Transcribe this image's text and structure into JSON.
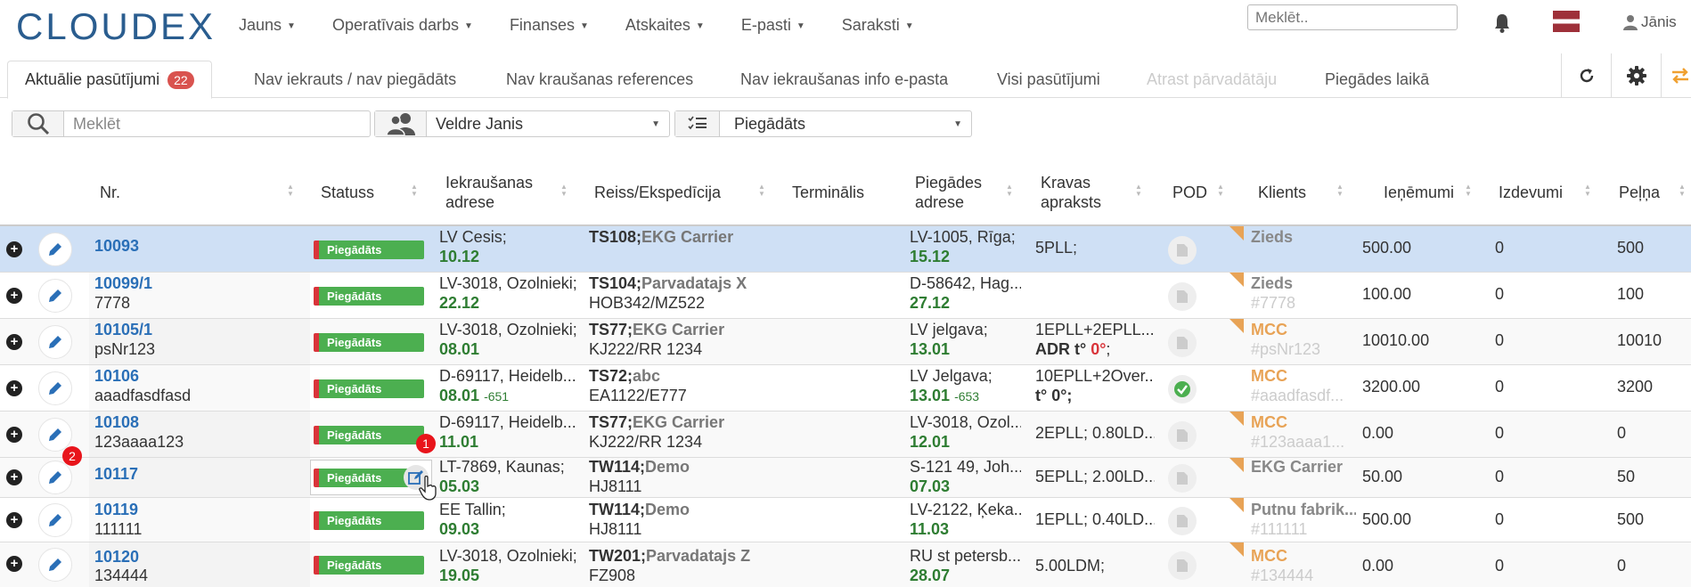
{
  "nav": {
    "logo": "CLOUDEX",
    "menu": [
      "Jauns",
      "Operatīvais darbs",
      "Finanses",
      "Atskaites",
      "E-pasti",
      "Saraksti"
    ],
    "search_placeholder": "Meklēt..",
    "user": "Jānis",
    "flag_color": "#9e3039"
  },
  "tabs": {
    "items": [
      {
        "label": "Aktuālie pasūtījumi",
        "badge": "22",
        "state": "active"
      },
      {
        "label": "Nav iekrauts / nav piegādāts",
        "state": "normal"
      },
      {
        "label": "Nav kraušanas references",
        "state": "normal"
      },
      {
        "label": "Nav iekraušanas info e-pasta",
        "state": "normal"
      },
      {
        "label": "Visi pasūtījumi",
        "state": "normal"
      },
      {
        "label": "Atrast pārvadātāju",
        "state": "disabled"
      },
      {
        "label": "Piegādes laikā",
        "state": "normal"
      }
    ],
    "tools": [
      "refresh-icon",
      "gear-icon",
      "swap-icon"
    ]
  },
  "filters": {
    "search_placeholder": "Meklēt",
    "user_value": "Veldre Janis",
    "status_value": "Piegādāts"
  },
  "table": {
    "headers": {
      "nr": "Nr.",
      "status": "Statuss",
      "loading_1": "Iekraušanas",
      "loading_2": "adrese",
      "trip": "Reiss/Ekspedīcija",
      "terminal": "Terminālis",
      "delivery_1": "Piegādes",
      "delivery_2": "adrese",
      "cargo_1": "Kravas",
      "cargo_2": "apraksts",
      "pod": "POD",
      "client": "Klients",
      "income": "Ieņēmumi",
      "expenses": "Izdevumi",
      "profit": "Peļņa"
    },
    "status_label": "Piegādāts",
    "rows": [
      {
        "nr": "10093",
        "nr_sub": "",
        "load_addr": "LV Cesis;",
        "load_date": "10.12",
        "trip": "TS108;",
        "carrier": "EKG Carrier",
        "trip_sub": "",
        "del_addr": "LV-1005, Rīga;",
        "del_date": "15.12",
        "del_extra": "",
        "cargo": "5PLL;",
        "cargo_sub": "",
        "client": "Zieds",
        "client_sub": "",
        "income": "500.00",
        "expenses": "0",
        "profit": "500"
      },
      {
        "nr": "10099/1",
        "nr_sub": "7778",
        "load_addr": "LV-3018, Ozolnieki;",
        "load_date": "22.12",
        "trip": "TS104;",
        "carrier": "Parvadatajs X",
        "trip_sub": "HOB342/MZ522",
        "del_addr": "D-58642, Hag...",
        "del_date": "27.12",
        "del_extra": "",
        "cargo": "",
        "cargo_sub": "",
        "client": "Zieds",
        "client_sub": "#7778",
        "income": "100.00",
        "expenses": "0",
        "profit": "100"
      },
      {
        "nr": "10105/1",
        "nr_sub": "psNr123",
        "load_addr": "LV-3018, Ozolnieki;",
        "load_date": "08.01",
        "trip": "TS77;",
        "carrier": "EKG Carrier",
        "trip_sub": "KJ222/RR 1234",
        "del_addr": "LV jelgava;",
        "del_date": "13.01",
        "del_extra": "",
        "cargo": "1EPLL+2EPLL...",
        "cargo_sub": "ADR t° 0°;",
        "client": "MCC",
        "client_sub": "#psNr123",
        "income": "10010.00",
        "expenses": "0",
        "profit": "10010"
      },
      {
        "nr": "10106",
        "nr_sub": "aaadfasdfasd",
        "load_addr": "D-69117, Heidelb...",
        "load_date": "08.01",
        "load_extra": "-651",
        "trip": "TS72;",
        "carrier": "abc",
        "trip_sub": "EA1122/E777",
        "del_addr": "LV Jelgava;",
        "del_date": "13.01",
        "del_extra": "-653",
        "cargo": "10EPLL+2Over...",
        "cargo_sub": "t° 0°;",
        "client": "MCC",
        "client_sub": "#aaadfasdf...",
        "income": "3200.00",
        "expenses": "0",
        "profit": "3200"
      },
      {
        "nr": "10108",
        "nr_sub": "123aaaa123",
        "load_addr": "D-69117, Heidelb...",
        "load_date": "11.01",
        "trip": "TS77;",
        "carrier": "EKG Carrier",
        "trip_sub": "KJ222/RR 1234",
        "del_addr": "LV-3018, Ozol...",
        "del_date": "12.01",
        "del_extra": "",
        "cargo": "2EPLL; 0.80LD...",
        "cargo_sub": "",
        "client": "MCC",
        "client_sub": "#123aaaa1...",
        "income": "0.00",
        "expenses": "0",
        "profit": "0"
      },
      {
        "nr": "10117",
        "nr_sub": "",
        "load_addr": "LT-7869, Kaunas;",
        "load_date": "05.03",
        "trip": "TW114;",
        "carrier": "Demo",
        "trip_sub": "HJ8111",
        "del_addr": "S-121 49, Joh...",
        "del_date": "07.03",
        "del_extra": "",
        "cargo": "5EPLL; 2.00LD...",
        "cargo_sub": "",
        "client": "EKG Carrier",
        "client_sub": "",
        "income": "50.00",
        "expenses": "0",
        "profit": "50"
      },
      {
        "nr": "10119",
        "nr_sub": "111111",
        "load_addr": "EE Tallin;",
        "load_date": "09.03",
        "trip": "TW114;",
        "carrier": "Demo",
        "trip_sub": "HJ8111",
        "del_addr": "LV-2122, Ķeka...",
        "del_date": "11.03",
        "del_extra": "",
        "cargo": "1EPLL; 0.40LD...",
        "cargo_sub": "",
        "client": "Putnu fabrik...",
        "client_sub": "#111111",
        "income": "500.00",
        "expenses": "0",
        "profit": "500"
      },
      {
        "nr": "10120",
        "nr_sub": "134444",
        "load_addr": "LV-3018, Ozolnieki;",
        "load_date": "19.05",
        "trip": "TW201;",
        "carrier": "Parvadatajs Z",
        "trip_sub": "FZ908",
        "del_addr": "RU st petersb...",
        "del_date": "28.07",
        "del_extra": "",
        "cargo": "5.00LDM;",
        "cargo_sub": "",
        "client": "MCC",
        "client_sub": "#134444",
        "income": "0.00",
        "expenses": "0",
        "profit": "0"
      }
    ]
  },
  "markers": [
    "1",
    "2"
  ],
  "colors": {
    "accent": "#2a6fb7",
    "status_green": "#4caf50",
    "status_red": "#d9343a",
    "client_orange": "#e8a356"
  }
}
